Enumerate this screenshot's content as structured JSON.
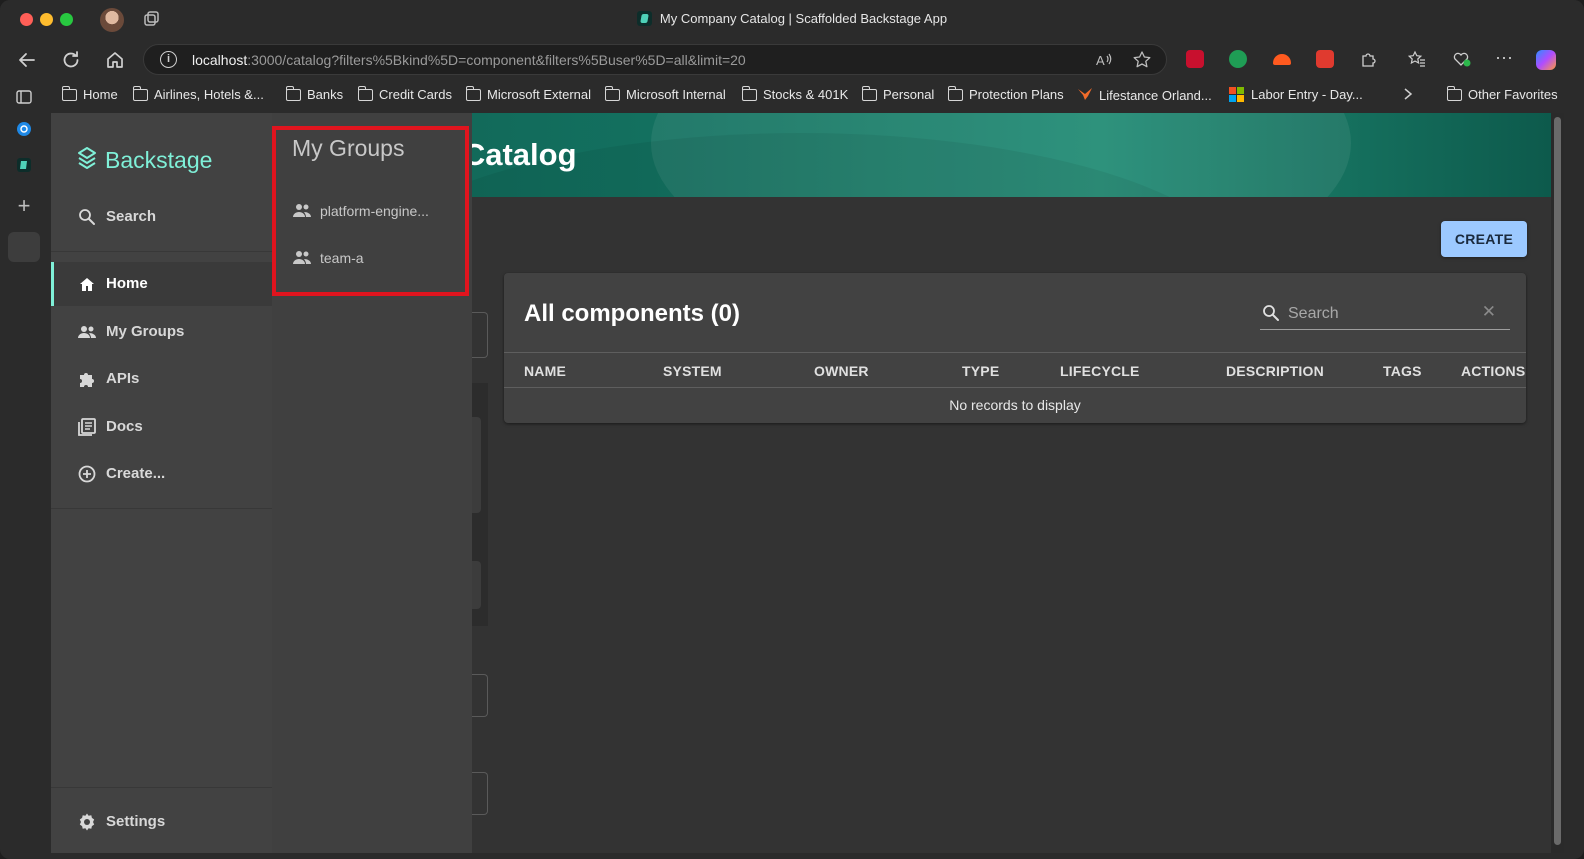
{
  "browser": {
    "window_title": "My Company Catalog | Scaffolded Backstage App",
    "url_host": "localhost",
    "url_rest": ":3000/catalog?filters%5Bkind%5D=component&filters%5Buser%5D=all&limit=20",
    "bookmarks": [
      "Home",
      "Airlines, Hotels &...",
      "Banks",
      "Credit Cards",
      "Microsoft External",
      "Microsoft Internal",
      "Stocks & 401K",
      "Personal",
      "Protection Plans",
      "Lifestance Orland...",
      "Labor Entry - Day...",
      "Other Favorites"
    ]
  },
  "sidebar": {
    "logo": "Backstage",
    "search_label": "Search",
    "items": [
      {
        "label": "Home",
        "icon": "home-icon"
      },
      {
        "label": "My Groups",
        "icon": "groups-icon"
      },
      {
        "label": "APIs",
        "icon": "puzzle-icon"
      },
      {
        "label": "Docs",
        "icon": "docs-icon"
      },
      {
        "label": "Create...",
        "icon": "add-circle-icon"
      }
    ],
    "settings_label": "Settings"
  },
  "flyout": {
    "title": "My Groups",
    "items": [
      {
        "label": "platform-engine..."
      },
      {
        "label": "team-a"
      }
    ]
  },
  "header": {
    "title_fragment": "y Catalog"
  },
  "toolbar": {
    "create_label": "CREATE"
  },
  "table": {
    "title": "All components (0)",
    "search_placeholder": "Search",
    "columns": [
      "NAME",
      "SYSTEM",
      "OWNER",
      "TYPE",
      "LIFECYCLE",
      "DESCRIPTION",
      "TAGS",
      "ACTIONS"
    ],
    "empty_message": "No records to display"
  },
  "colors": {
    "accent": "#7ff0d8",
    "create_button": "#9cc9ff",
    "highlight_border": "#e0141e",
    "header_band": "#13705f"
  }
}
